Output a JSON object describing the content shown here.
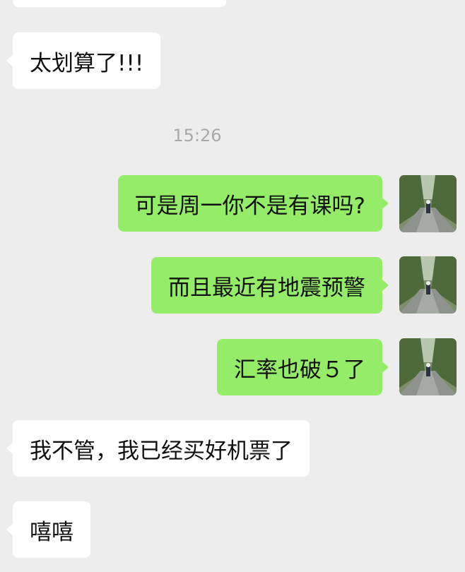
{
  "chat": {
    "timestamp": "15:26",
    "messages": [
      {
        "side": "in",
        "text": ""
      },
      {
        "side": "in",
        "text": "太划算了!!!"
      },
      {
        "side": "out",
        "text": "可是周一你不是有课吗?"
      },
      {
        "side": "out",
        "text": "而且最近有地震预警"
      },
      {
        "side": "out",
        "text": "汇率也破５了"
      },
      {
        "side": "in",
        "text": "我不管，我已经买好机票了"
      },
      {
        "side": "in",
        "text": "嘻嘻"
      }
    ]
  },
  "colors": {
    "background": "#ededed",
    "incoming_bubble": "#ffffff",
    "outgoing_bubble": "#95ec69",
    "timestamp_text": "#a8a8a8"
  },
  "icons": {
    "avatar": "tree-lined-road-avatar-icon"
  }
}
